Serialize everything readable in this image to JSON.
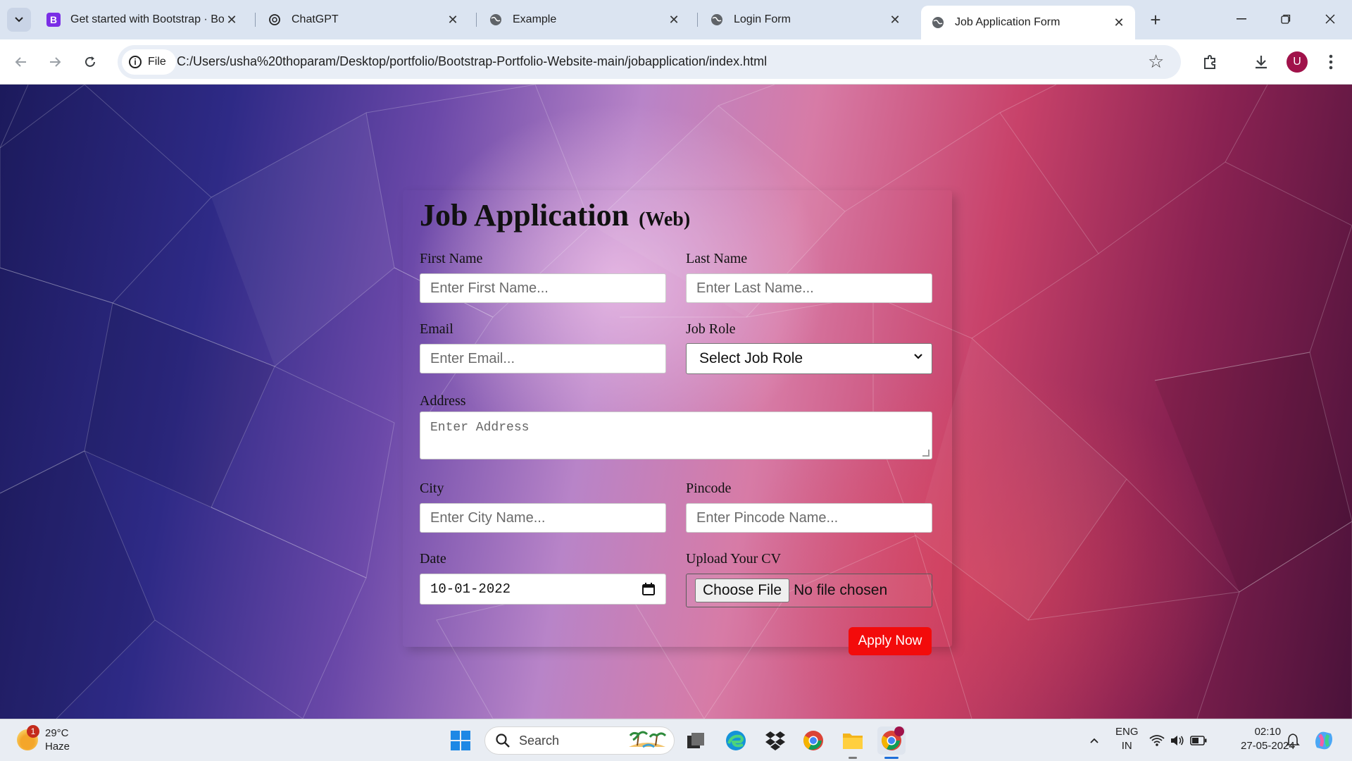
{
  "browser": {
    "tabs": [
      {
        "title": "Get started with Bootstrap · Boot",
        "favicon": "bootstrap-icon",
        "active": false
      },
      {
        "title": "ChatGPT",
        "favicon": "chatgpt-icon",
        "active": false
      },
      {
        "title": "Example",
        "favicon": "globe-icon",
        "active": false
      },
      {
        "title": "Login Form",
        "favicon": "globe-icon",
        "active": false
      },
      {
        "title": "Job Application Form",
        "favicon": "globe-icon",
        "active": true
      }
    ],
    "chip_label": "File",
    "url": "C:/Users/usha%20thoparam/Desktop/portfolio/Bootstrap-Portfolio-Website-main/jobapplication/index.html",
    "profile_initial": "U"
  },
  "form": {
    "title": "Job Application",
    "title_sub": "(Web)",
    "first_name": {
      "label": "First Name",
      "placeholder": "Enter First Name..."
    },
    "last_name": {
      "label": "Last Name",
      "placeholder": "Enter Last Name..."
    },
    "email": {
      "label": "Email",
      "placeholder": "Enter Email..."
    },
    "job_role": {
      "label": "Job Role",
      "selected": "Select Job Role"
    },
    "address": {
      "label": "Address",
      "placeholder": "Enter Address"
    },
    "city": {
      "label": "City",
      "placeholder": "Enter City Name..."
    },
    "pincode": {
      "label": "Pincode",
      "placeholder": "Enter Pincode Name..."
    },
    "date": {
      "label": "Date",
      "value": "10-01-2022"
    },
    "cv": {
      "label": "Upload Your CV",
      "button": "Choose File",
      "status": "No file chosen"
    },
    "submit": "Apply Now"
  },
  "taskbar": {
    "weather": {
      "temp": "29°C",
      "condition": "Haze",
      "badge": "1"
    },
    "search_placeholder": "Search",
    "lang": "ENG",
    "region": "IN",
    "time": "02:10",
    "date": "27-05-2024"
  }
}
